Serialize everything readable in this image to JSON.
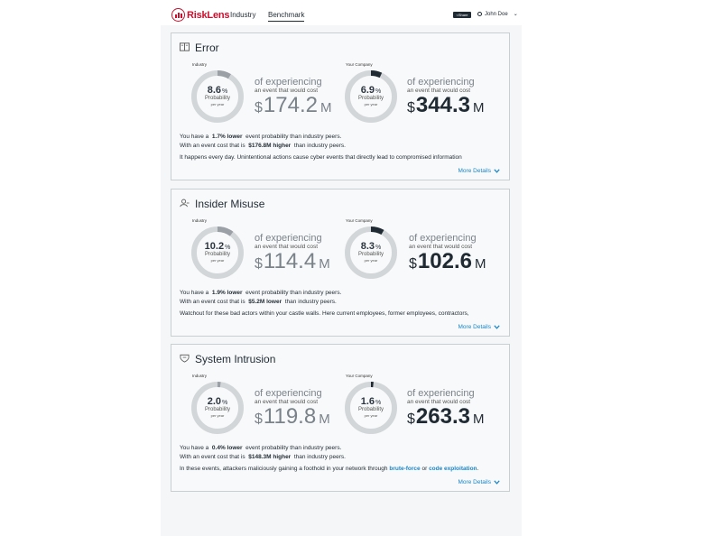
{
  "header": {
    "logo_text": "RiskLens",
    "nav": [
      "Industry",
      "Benchmark"
    ],
    "active_nav": "Benchmark",
    "share_label": "Share",
    "user_name": "John Doe"
  },
  "colors": {
    "brand": "#c8102e",
    "link": "#1a86c7",
    "ring": "#d3d6d9",
    "industry_arc": "#9aa0a6",
    "company_arc": "#1f2a33"
  },
  "cards": [
    {
      "title": "Error",
      "icon": "book-icon",
      "industry": {
        "label": "Industry",
        "prob": "8.6",
        "fraction": 0.086,
        "amount": "174.2"
      },
      "company": {
        "label": "Your Company",
        "prob": "6.9",
        "fraction": 0.069,
        "amount": "344.3"
      },
      "compare": {
        "p1": "You have a",
        "v1": "1.7% lower",
        "s1": "event probability than industry peers.",
        "p2": "With an event cost that is",
        "v2": "$176.8M higher",
        "s2": "than industry peers."
      },
      "desc": "It happens every day. Unintentional actions cause cyber events that directly lead to compromised information",
      "more": "More Details"
    },
    {
      "title": "Insider Misuse",
      "icon": "user-minus-icon",
      "industry": {
        "label": "Industry",
        "prob": "10.2",
        "fraction": 0.102,
        "amount": "114.4"
      },
      "company": {
        "label": "Your Company",
        "prob": "8.3",
        "fraction": 0.083,
        "amount": "102.6"
      },
      "compare": {
        "p1": "You have a",
        "v1": "1.9% lower",
        "s1": "event probability than industry peers.",
        "p2": "With an event cost that is",
        "v2": "$5.2M lower",
        "s2": "than industry peers."
      },
      "desc": "Watchout for these bad actors within your castle walls. Here current employees, former employees, contractors,",
      "more": "More Details"
    },
    {
      "title": "System Intrusion",
      "icon": "shield-icon",
      "industry": {
        "label": "Industry",
        "prob": "2.0",
        "fraction": 0.02,
        "amount": "119.8"
      },
      "company": {
        "label": "Your Company",
        "prob": "1.6",
        "fraction": 0.016,
        "amount": "263.3"
      },
      "compare": {
        "p1": "You have a",
        "v1": "0.4% lower",
        "s1": "event probability than industry peers.",
        "p2": "With an event cost that is",
        "v2": "$148.3M higher",
        "s2": "than industry peers."
      },
      "desc_pre": "In these events, attackers maliciously gaining a foothold in your network through",
      "desc_link1": "brute-force",
      "desc_or": "or",
      "desc_link2": "code exploitation",
      "desc_end": ".",
      "more": "More Details"
    }
  ],
  "labels": {
    "percent": "%",
    "probability": "Probability",
    "per_year": "per year",
    "of_experiencing": "of experiencing",
    "event_cost": "an event that would cost",
    "currency": "$",
    "unit": "M"
  }
}
